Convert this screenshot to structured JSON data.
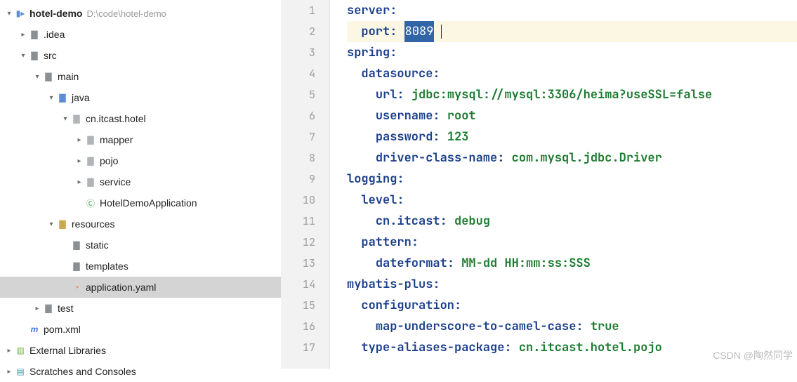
{
  "tree": {
    "root": {
      "label": "hotel-demo",
      "hint": "D:\\code\\hotel-demo"
    },
    "idea": {
      "label": ".idea"
    },
    "src": {
      "label": "src"
    },
    "main": {
      "label": "main"
    },
    "java": {
      "label": "java"
    },
    "pkg": {
      "label": "cn.itcast.hotel"
    },
    "mapper": {
      "label": "mapper"
    },
    "pojo": {
      "label": "pojo"
    },
    "service": {
      "label": "service"
    },
    "app": {
      "label": "HotelDemoApplication"
    },
    "resources": {
      "label": "resources"
    },
    "static": {
      "label": "static"
    },
    "templates": {
      "label": "templates"
    },
    "appyaml": {
      "label": "application.yaml"
    },
    "test": {
      "label": "test"
    },
    "pom": {
      "label": "pom.xml"
    },
    "extlib": {
      "label": "External Libraries"
    },
    "scratch": {
      "label": "Scratches and Consoles"
    }
  },
  "editor": {
    "line_count": 17,
    "current_line": 2,
    "selected_value": "8089",
    "k_server": "server",
    "k_port": "port",
    "k_spring": "spring",
    "k_ds": "datasource",
    "k_url": "url",
    "v_url": "jdbc:mysql://mysql:3306/heima?useSSL=false",
    "k_user": "username",
    "v_user": "root",
    "k_pass": "password",
    "v_pass": "123",
    "k_driver": "driver-class-name",
    "v_driver": "com.mysql.jdbc.Driver",
    "k_logging": "logging",
    "k_level": "level",
    "k_cnitcast": "cn.itcast",
    "v_debug": "debug",
    "k_pattern": "pattern",
    "k_datefmt": "dateformat",
    "v_datefmt": "MM-dd HH:mm:ss:SSS",
    "k_mp": "mybatis-plus",
    "k_conf": "configuration",
    "k_mucc": "map-underscore-to-camel-case",
    "v_true": "true",
    "k_tap": "type-aliases-package",
    "v_tap": "cn.itcast.hotel.pojo"
  },
  "watermark": "CSDN @陶然同学"
}
